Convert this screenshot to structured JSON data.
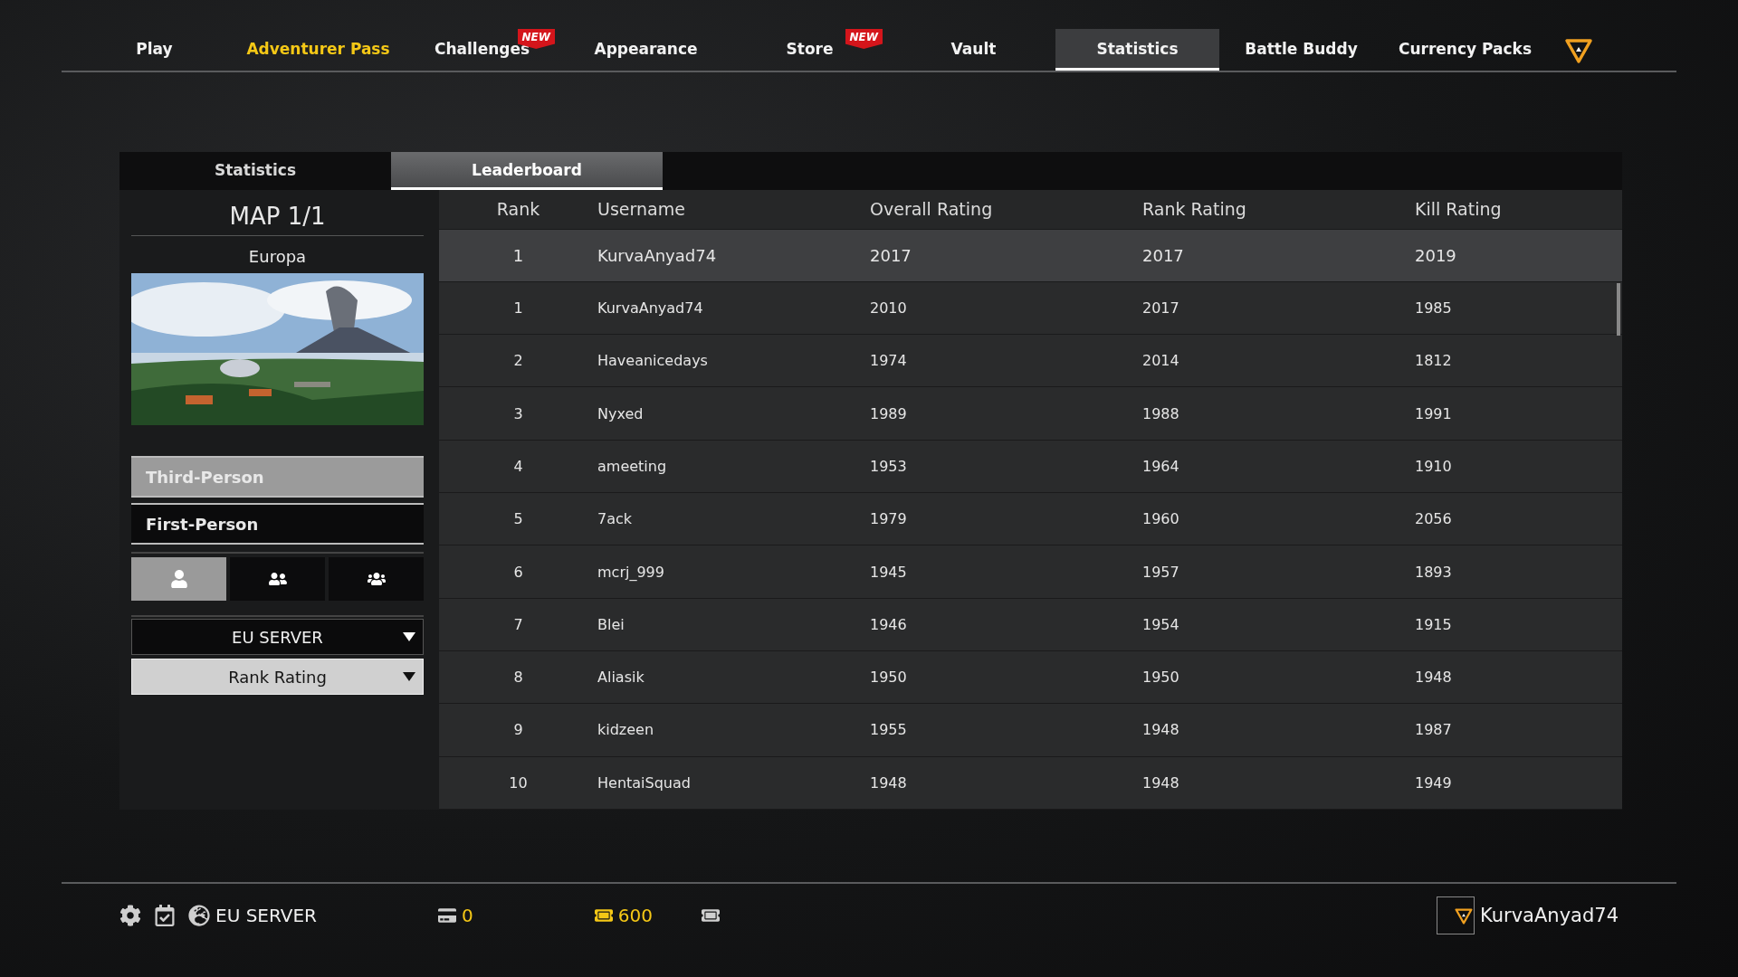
{
  "nav": {
    "tabs": [
      {
        "label": "Play",
        "selected": false,
        "accent": false
      },
      {
        "label": "Adventurer Pass",
        "selected": false,
        "accent": true
      },
      {
        "label": "Challenges",
        "selected": false,
        "accent": false,
        "badge": "NEW"
      },
      {
        "label": "Appearance",
        "selected": false,
        "accent": false
      },
      {
        "label": "Store",
        "selected": false,
        "accent": false,
        "badge": "NEW"
      },
      {
        "label": "Vault",
        "selected": false,
        "accent": false
      },
      {
        "label": "Statistics",
        "selected": true,
        "accent": false
      },
      {
        "label": "Battle Buddy",
        "selected": false,
        "accent": false
      },
      {
        "label": "Currency Packs",
        "selected": false,
        "accent": false
      }
    ]
  },
  "sub_tabs": [
    {
      "label": "Statistics",
      "selected": false
    },
    {
      "label": "Leaderboard",
      "selected": true
    }
  ],
  "sidebar": {
    "map_counter": "MAP 1/1",
    "map_name": "Europa",
    "perspectives": [
      {
        "label": "Third-Person",
        "selected": true
      },
      {
        "label": "First-Person",
        "selected": false
      }
    ],
    "squad_sizes": [
      {
        "kind": "solo",
        "selected": true
      },
      {
        "kind": "duo",
        "selected": false
      },
      {
        "kind": "squad",
        "selected": false
      }
    ],
    "dropdowns": [
      {
        "value": "EU SERVER",
        "kind": "dark"
      },
      {
        "value": "Rank Rating",
        "kind": "light"
      }
    ]
  },
  "table": {
    "columns": [
      "Rank",
      "Username",
      "Overall Rating",
      "Rank Rating",
      "Kill Rating"
    ],
    "rows": [
      {
        "selected": true,
        "cells": [
          "1",
          "KurvaAnyad74",
          "2017",
          "2017",
          "2019"
        ]
      },
      {
        "selected": false,
        "cells": [
          "1",
          "KurvaAnyad74",
          "2010",
          "2017",
          "1985"
        ]
      },
      {
        "selected": false,
        "cells": [
          "2",
          "Haveanicedays",
          "1974",
          "2014",
          "1812"
        ]
      },
      {
        "selected": false,
        "cells": [
          "3",
          "Nyxed",
          "1989",
          "1988",
          "1991"
        ]
      },
      {
        "selected": false,
        "cells": [
          "4",
          "ameeting",
          "1953",
          "1964",
          "1910"
        ]
      },
      {
        "selected": false,
        "cells": [
          "5",
          "7ack",
          "1979",
          "1960",
          "2056"
        ]
      },
      {
        "selected": false,
        "cells": [
          "6",
          "mcrj_999",
          "1945",
          "1957",
          "1893"
        ]
      },
      {
        "selected": false,
        "cells": [
          "7",
          "Blei",
          "1946",
          "1954",
          "1915"
        ]
      },
      {
        "selected": false,
        "cells": [
          "8",
          "Aliasik",
          "1950",
          "1950",
          "1948"
        ]
      },
      {
        "selected": false,
        "cells": [
          "9",
          "kidzeen",
          "1955",
          "1948",
          "1987"
        ]
      },
      {
        "selected": false,
        "cells": [
          "10",
          "HentaiSquad",
          "1948",
          "1948",
          "1949"
        ]
      }
    ]
  },
  "status_bar": {
    "server": "EU SERVER",
    "currencies": [
      {
        "kind": "card",
        "value": "0"
      },
      {
        "kind": "bp",
        "value": "600"
      },
      {
        "kind": "ticket"
      }
    ],
    "username": "KurvaAnyad74"
  }
}
